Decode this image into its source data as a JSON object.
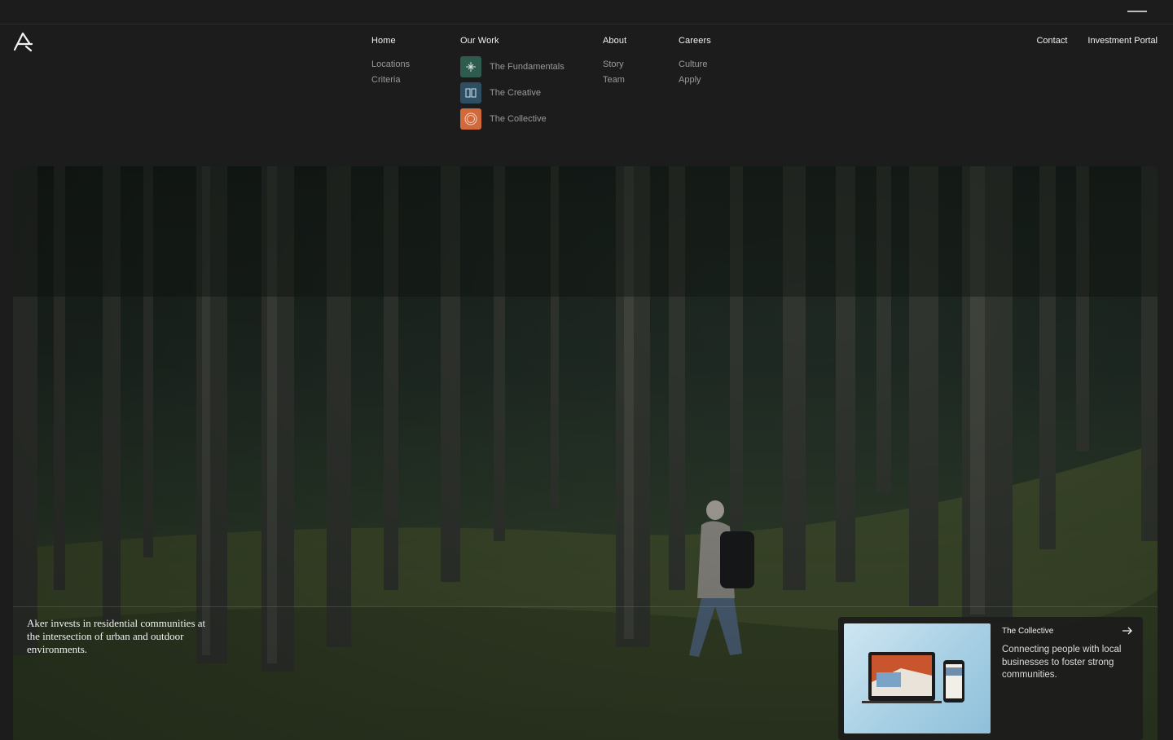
{
  "header": {
    "logo_name": "aker-logo"
  },
  "nav": {
    "home": {
      "label": "Home",
      "items": [
        "Locations",
        "Criteria"
      ]
    },
    "work": {
      "label": "Our Work",
      "items": [
        {
          "label": "The Fundamentals",
          "icon": "fundamentals-icon",
          "color": "#2f5a4e"
        },
        {
          "label": "The Creative",
          "icon": "creative-icon",
          "color": "#2e4f63"
        },
        {
          "label": "The Collective",
          "icon": "collective-icon",
          "color": "#d2693a"
        }
      ]
    },
    "about": {
      "label": "About",
      "items": [
        "Story",
        "Team"
      ]
    },
    "careers": {
      "label": "Careers",
      "items": [
        "Culture",
        "Apply"
      ]
    },
    "right": {
      "contact": "Contact",
      "portal": "Investment Portal"
    }
  },
  "hero": {
    "tagline": "Aker invests in residential communities at the intersection of urban and outdoor environments."
  },
  "card": {
    "label": "The Collective",
    "description": "Connecting people with local businesses to foster strong communities.",
    "arrow_icon": "arrow-right-icon"
  },
  "colors": {
    "background": "#1c1c1c",
    "text": "#f1f1f1",
    "muted": "#9a9a9a"
  }
}
